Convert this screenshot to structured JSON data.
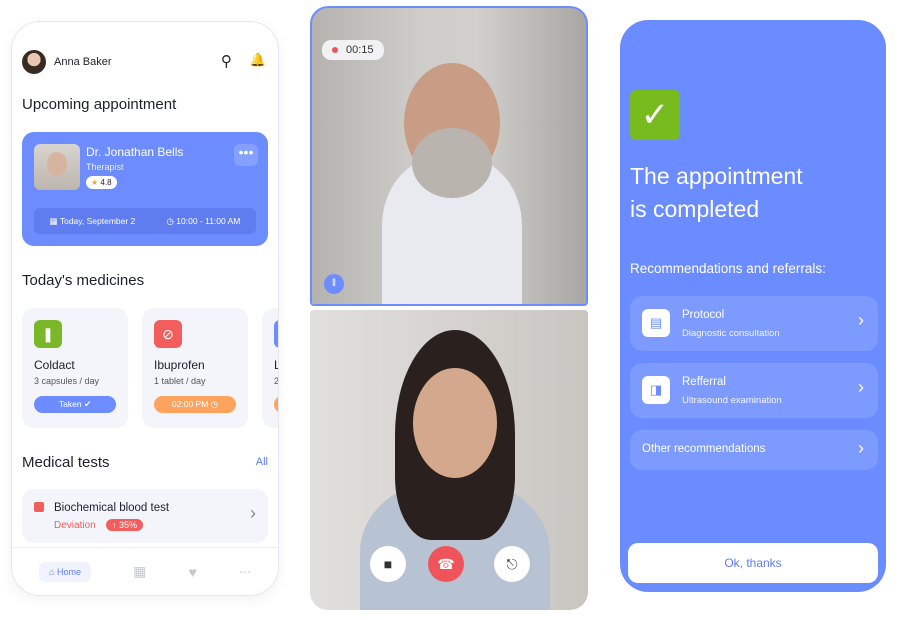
{
  "home": {
    "user_name": "Anna Baker",
    "upcoming_title": "Upcoming appointment",
    "appointment": {
      "doctor": "Dr. Jonathan Bells",
      "specialty": "Therapist",
      "rating": "4.8",
      "date": "Today, September 2",
      "time": "10:00 - 11:00 AM",
      "more": "•••"
    },
    "medicines_title": "Today's medicines",
    "medicines": [
      {
        "name": "Coldact",
        "dose": "3 capsules / day",
        "status": "Taken",
        "color": "#7ab829",
        "pill_color": "#6c8cff"
      },
      {
        "name": "Ibuprofen",
        "dose": "1 tablet / day",
        "status": "02:00 PM",
        "color": "#f25d5d",
        "pill_color": "#fda35d"
      },
      {
        "name": "L",
        "dose": "2"
      }
    ],
    "tests_title": "Medical tests",
    "tests_all": "All",
    "test": {
      "name": "Biochemical blood test",
      "status": "Deviation",
      "change": "↑ 35%"
    },
    "nav": {
      "home": "Home"
    }
  },
  "call": {
    "timer": "00:15"
  },
  "completed": {
    "title_line1": "The appointment",
    "title_line2": "is completed",
    "subtitle": "Recommendations and referrals:",
    "items": [
      {
        "title": "Protocol",
        "subtitle": "Diagnostic consultation"
      },
      {
        "title": "Refferral",
        "subtitle": "Ultrasound examination"
      },
      {
        "title": "Other recommendations"
      }
    ],
    "ok_button": "Ok, thanks"
  },
  "colors": {
    "accent": "#6c8cff",
    "danger": "#f25d5d",
    "success": "#77bb1f"
  }
}
